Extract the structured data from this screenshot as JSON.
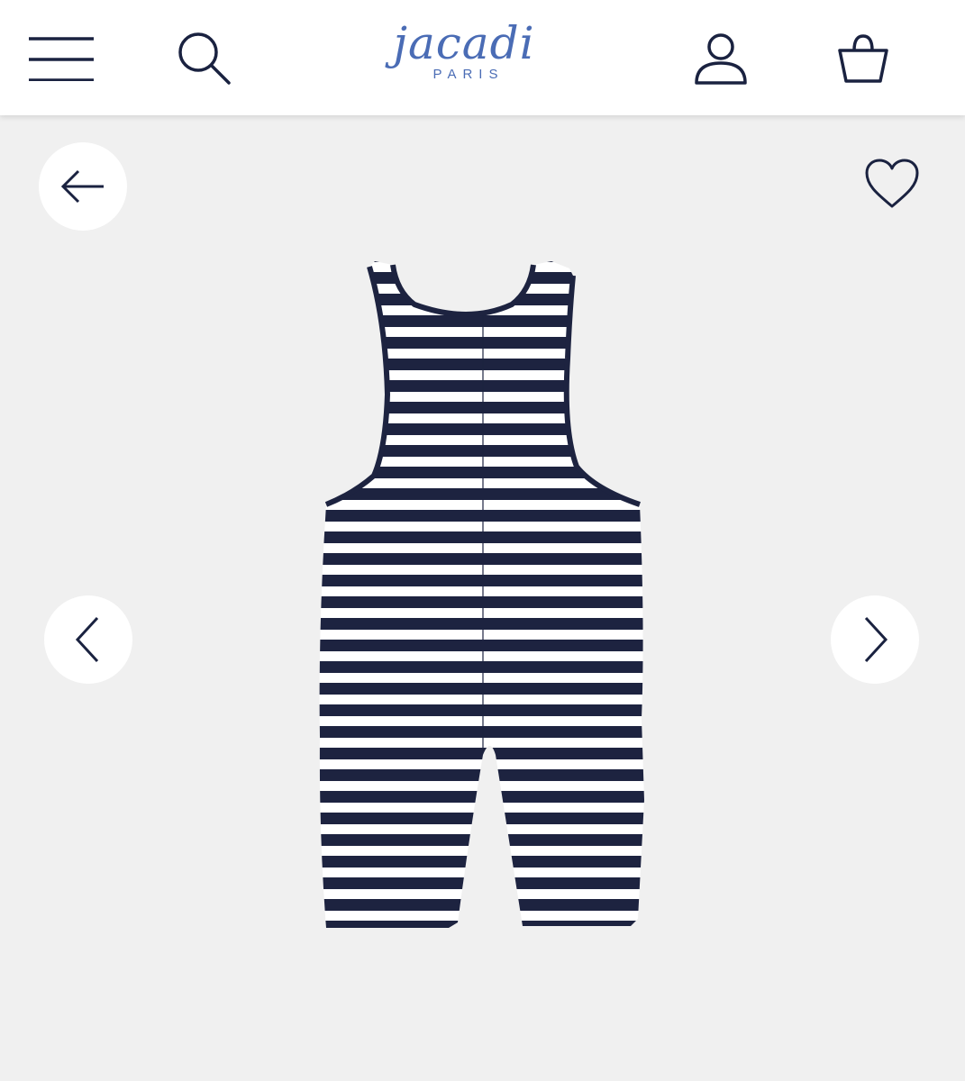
{
  "header": {
    "logo_text": "jacadi",
    "logo_subtext": "PARIS",
    "icons": {
      "menu": "hamburger-menu-icon",
      "search": "search-icon",
      "account": "user-icon",
      "bag": "shopping-bag-icon"
    }
  },
  "gallery": {
    "icons": {
      "back": "arrow-left-icon",
      "favorite": "heart-icon",
      "previous": "chevron-left-icon",
      "next": "chevron-right-icon"
    },
    "product_image": "striped-sleeveless-romper-back-view",
    "colors": {
      "stripe_navy": "#1d2340",
      "stripe_white": "#ffffff",
      "background": "#f0f0f0"
    }
  },
  "colors": {
    "brand": "#4a6cb5",
    "icon": "#1a2240",
    "header_bg": "#ffffff"
  }
}
